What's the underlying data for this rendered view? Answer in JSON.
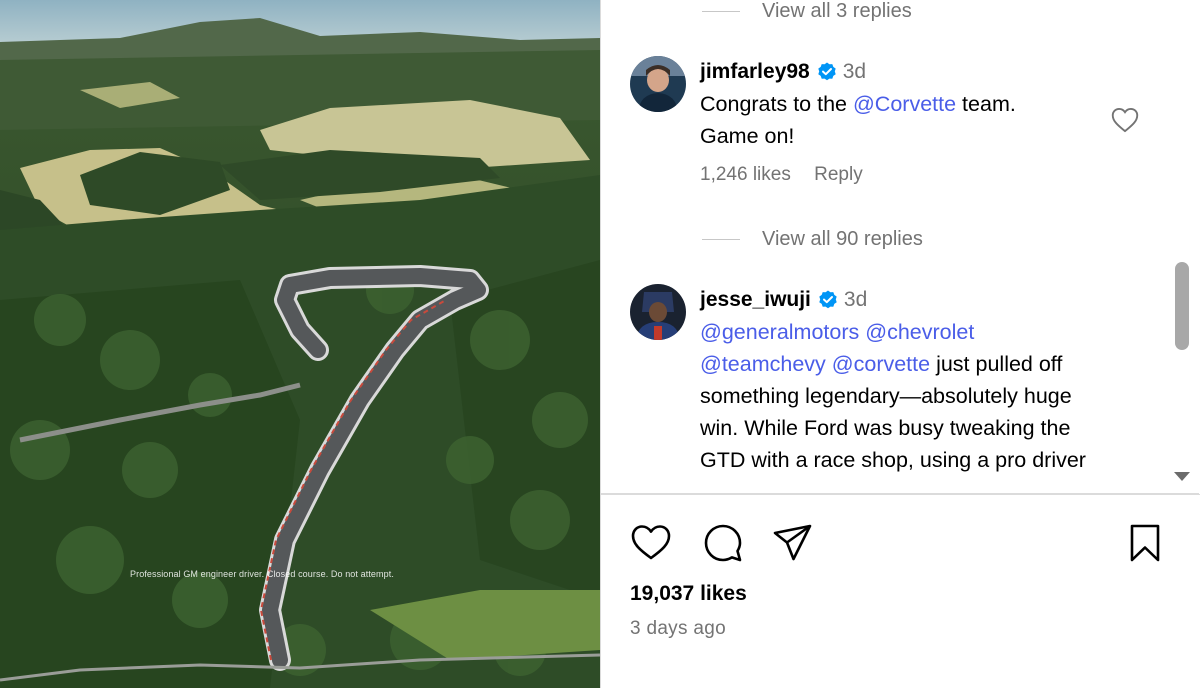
{
  "post": {
    "photo_caption": "Professional GM engineer driver. Closed course. Do not attempt.",
    "likes": "19,037 likes",
    "date": "3 days ago"
  },
  "comments": {
    "top_view_replies": "View all 3 replies",
    "items": [
      {
        "username": "jimfarley98",
        "verified": true,
        "time": "3d",
        "text_before": "Congrats to the ",
        "mention": "@Corvette",
        "text_after": " team. Game on!",
        "likes": "1,246 likes",
        "reply": "Reply",
        "view_replies": "View all 90 replies"
      },
      {
        "username": "jesse_iwuji",
        "verified": true,
        "time": "3d",
        "mention_1": "@generalmotors",
        "mention_2": "@chevrolet",
        "mention_3": "@teamchevy",
        "mention_4": "@corvette",
        "text_after": " just pulled off something legendary—absolutely huge win. While Ford was busy tweaking the GTD with a race shop, using a pro driver"
      }
    ]
  },
  "icons": {
    "like": "heart-icon",
    "comment": "comment-icon",
    "share": "share-icon",
    "save": "bookmark-icon",
    "comment_like": "heart-outline-icon",
    "verified": "verified-badge-icon"
  },
  "colors": {
    "mention": "#4a5de8",
    "verified": "#0095f6",
    "secondary_text": "#737373"
  }
}
